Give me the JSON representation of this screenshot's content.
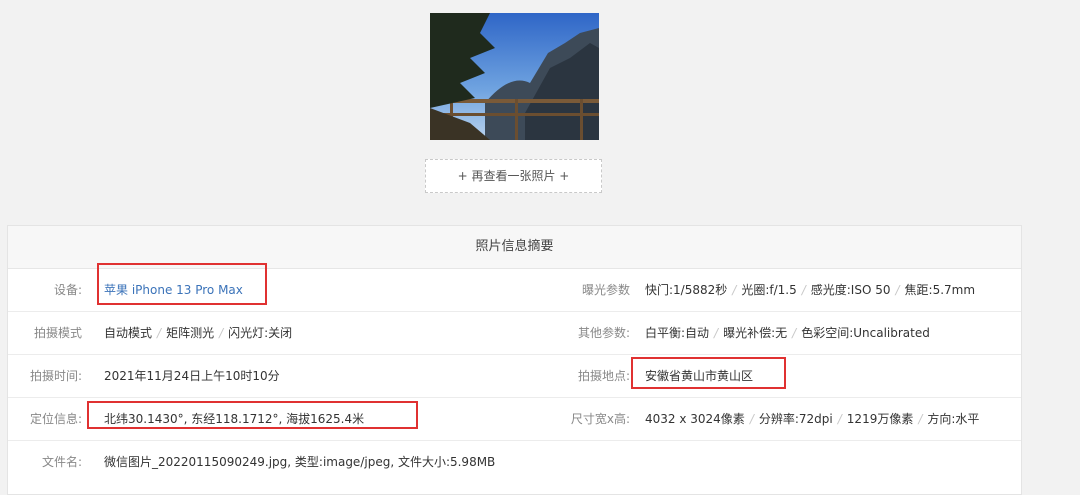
{
  "more_photo_label": "+ 再查看一张照片 +",
  "panel_title": "照片信息摘要",
  "rows": [
    {
      "left_label": "设备:",
      "left_value": "苹果 iPhone 13 Pro Max",
      "right_label": "曝光参数",
      "right_items": [
        "快门:1/5882秒",
        "光圈:f/1.5",
        "感光度:ISO 50",
        "焦距:5.7mm"
      ]
    },
    {
      "left_label": "拍摄模式",
      "left_items": [
        "自动模式",
        "矩阵测光",
        "闪光灯:关闭"
      ],
      "right_label": "其他参数:",
      "right_items": [
        "白平衡:自动",
        "曝光补偿:无",
        "色彩空间:Uncalibrated"
      ]
    },
    {
      "left_label": "拍摄时间:",
      "left_value": "2021年11月24日上午10时10分",
      "right_label": "拍摄地点:",
      "right_value": "安徽省黄山市黄山区"
    },
    {
      "left_label": "定位信息:",
      "left_value": "北纬30.1430°, 东经118.1712°, 海拔1625.4米",
      "right_label": "尺寸宽x高:",
      "right_items": [
        "4032 x 3024像素",
        "分辨率:72dpi",
        "1219万像素",
        "方向:水平"
      ]
    },
    {
      "left_label": "文件名:",
      "left_value": "微信图片_20220115090249.jpg, 类型:image/jpeg, 文件大小:5.98MB"
    }
  ],
  "colors": {
    "link": "#3b73b9",
    "highlight_box": "#e03131",
    "label": "#888888"
  }
}
